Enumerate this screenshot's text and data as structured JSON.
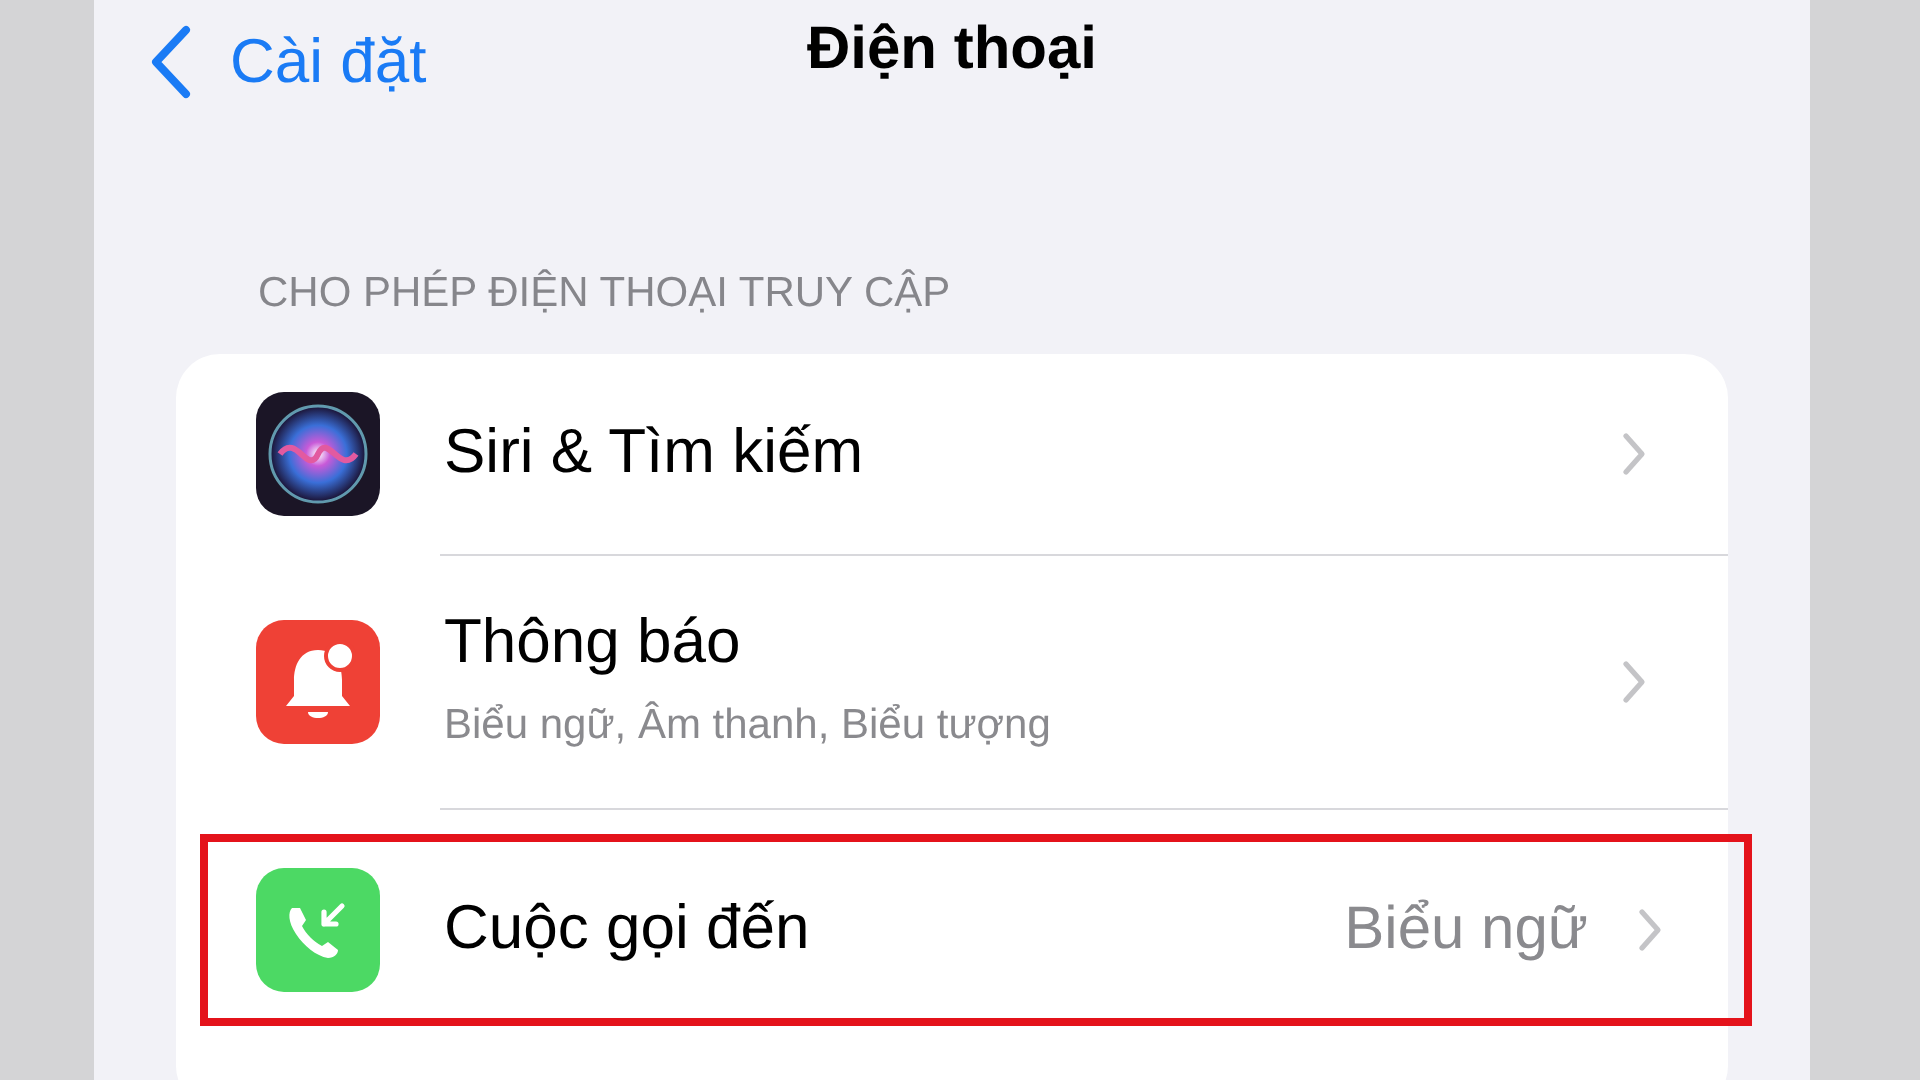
{
  "nav": {
    "back_label": "Cài đặt",
    "title": "Điện thoại"
  },
  "section": {
    "header": "CHO PHÉP ĐIỆN THOẠI TRUY CẬP",
    "rows": [
      {
        "kind": "siri",
        "title": "Siri & Tìm kiếm",
        "highlighted": false
      },
      {
        "kind": "notifications",
        "title": "Thông báo",
        "subtitle": "Biểu ngữ, Âm thanh, Biểu tượng",
        "highlighted": false
      },
      {
        "kind": "calls",
        "title": "Cuộc gọi đến",
        "value": "Biểu ngữ",
        "highlighted": true
      }
    ]
  }
}
